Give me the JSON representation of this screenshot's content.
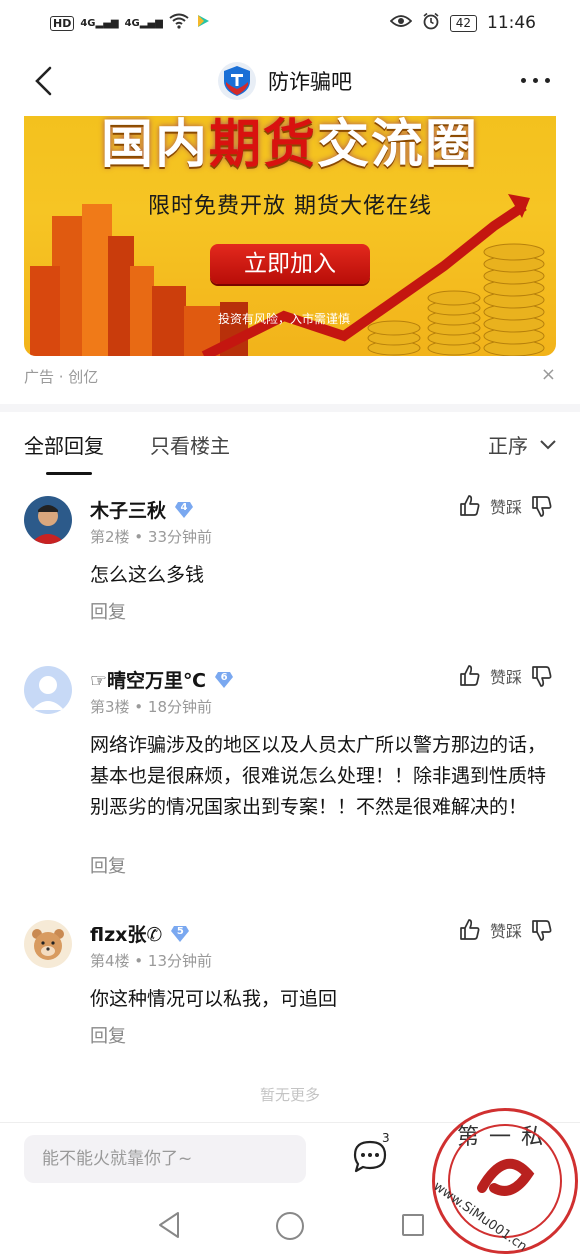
{
  "statusbar": {
    "hd": "HD",
    "sig1": "4G",
    "sig2": "4G",
    "battery": "42",
    "time": "11:46"
  },
  "nav": {
    "title": "防诈骗吧"
  },
  "ad": {
    "headline_white1": "国内",
    "headline_red": "期货",
    "headline_white2": "交流圈",
    "subline": "限时免费开放   期货大佬在线",
    "cta": "立即加入",
    "risk": "投资有风险，入市需谨慎",
    "label": "广告 · 创亿",
    "close": "×"
  },
  "tabs": {
    "all": "全部回复",
    "host": "只看楼主",
    "sort": "正序"
  },
  "replies": [
    {
      "name": "木子三秋",
      "level": "4",
      "meta": "第2楼 • 33分钟前",
      "body": "怎么这么多钱",
      "reply": "回复",
      "vote": "赞踩"
    },
    {
      "name": "☞晴空万里℃",
      "level": "6",
      "meta": "第3楼 • 18分钟前",
      "body": "网络诈骗涉及的地区以及人员太广所以警方那边的话，基本也是很麻烦，很难说怎么处理！！除非遇到性质特别恶劣的情况国家出到专案！！不然是很难解决的！",
      "reply": "回复",
      "vote": "赞踩"
    },
    {
      "name": "flzx张✆",
      "level": "5",
      "meta": "第4楼 • 13分钟前",
      "body": "你这种情况可以私我，可追回",
      "reply": "回复",
      "vote": "赞踩"
    }
  ],
  "nomore": "暂无更多",
  "bottom": {
    "placeholder": "能不能火就靠你了~",
    "comment_count": "3"
  },
  "watermark": {
    "text": "第一私",
    "url": "www.SiMu001.cn"
  }
}
